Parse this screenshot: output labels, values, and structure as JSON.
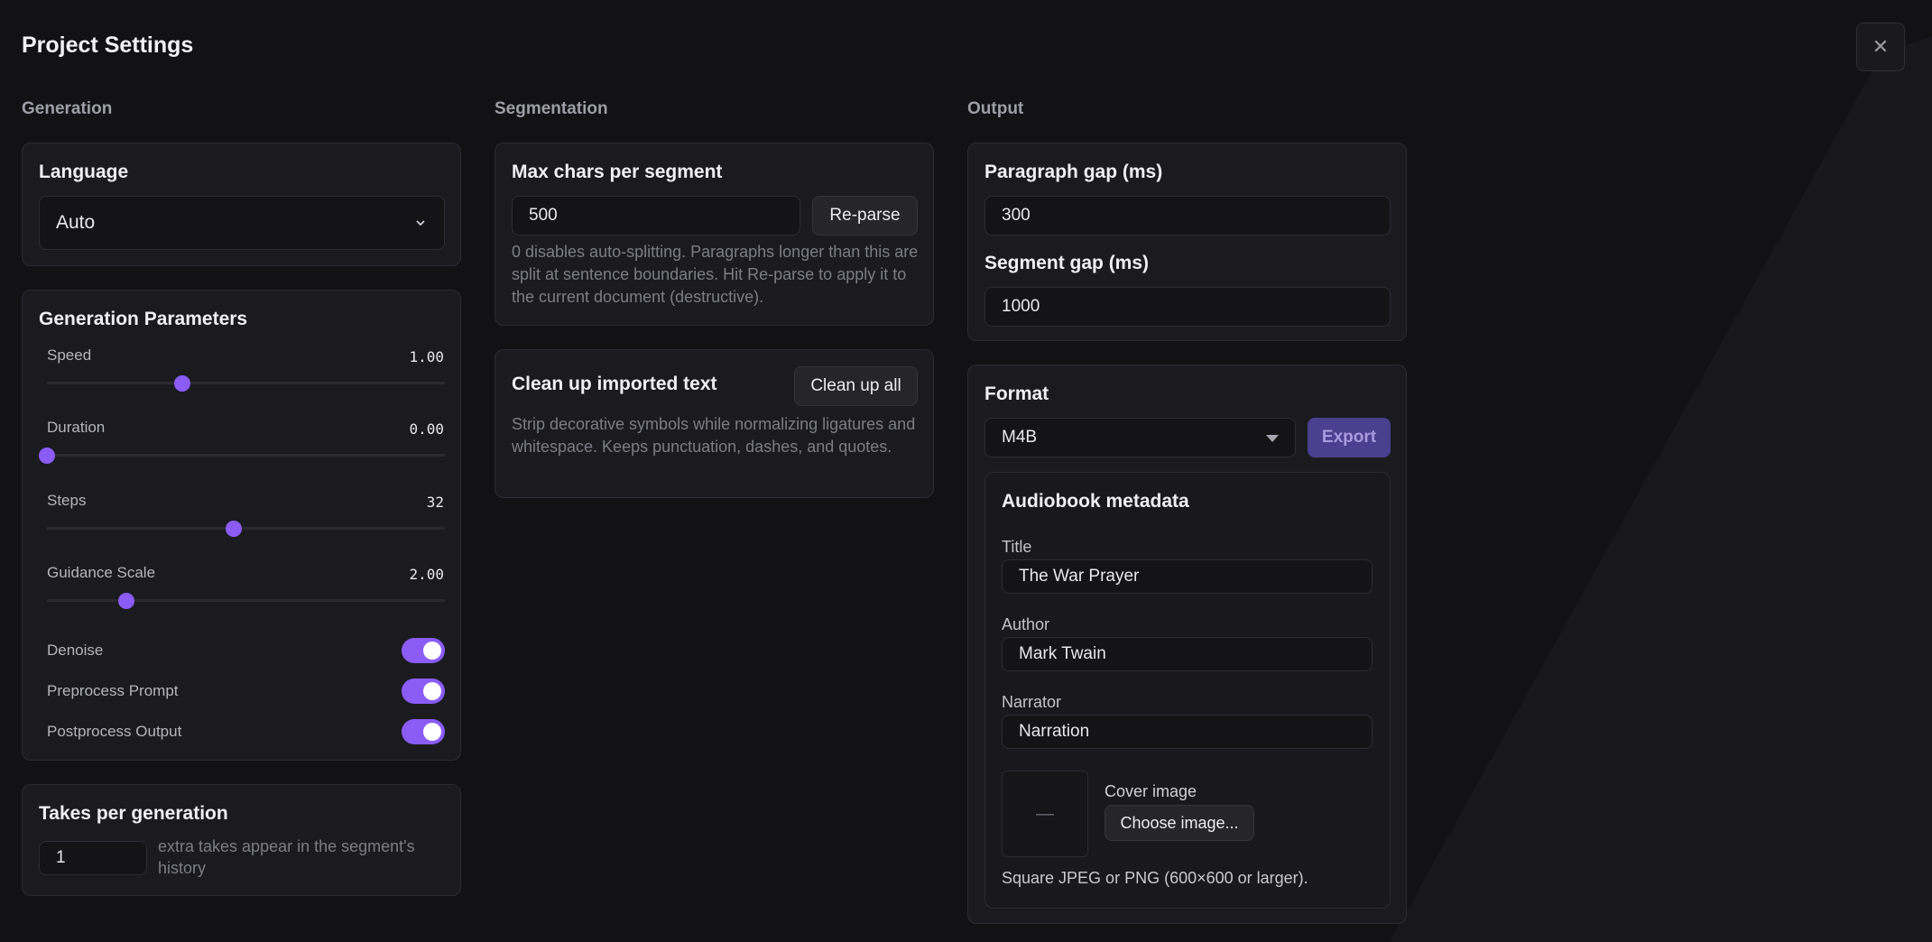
{
  "title": "Project Settings",
  "close_glyph": "✕",
  "columns": {
    "generation": "Generation",
    "segmentation": "Segmentation",
    "output": "Output"
  },
  "language": {
    "title": "Language",
    "value": "Auto"
  },
  "params": {
    "title": "Generation Parameters",
    "sliders": [
      {
        "label": "Speed",
        "display": "1.00",
        "fraction": 0.34
      },
      {
        "label": "Duration",
        "display": "0.00",
        "fraction": 0.0
      },
      {
        "label": "Steps",
        "display": "32",
        "fraction": 0.47
      },
      {
        "label": "Guidance Scale",
        "display": "2.00",
        "fraction": 0.2
      }
    ],
    "toggles": [
      {
        "label": "Denoise",
        "on": true
      },
      {
        "label": "Preprocess Prompt",
        "on": true
      },
      {
        "label": "Postprocess Output",
        "on": true
      }
    ]
  },
  "takes": {
    "title": "Takes per generation",
    "value": "1",
    "help": "extra takes appear in the segment's history"
  },
  "segment": {
    "title": "Max chars per segment",
    "value": "500",
    "reparse_label": "Re-parse",
    "help": "0 disables auto-splitting. Paragraphs longer than this are split at sentence boundaries. Hit Re-parse to apply it to the current document (destructive)."
  },
  "cleanup": {
    "title": "Clean up imported text",
    "button": "Clean up all",
    "help": "Strip decorative symbols while normalizing ligatures and whitespace. Keeps punctuation, dashes, and quotes."
  },
  "gaps": {
    "paragraph_label": "Paragraph gap (ms)",
    "paragraph_value": "300",
    "segment_label": "Segment gap (ms)",
    "segment_value": "1000"
  },
  "format": {
    "title": "Format",
    "value": "M4B",
    "export_label": "Export",
    "metadata": {
      "title": "Audiobook metadata",
      "title_label": "Title",
      "title_value": "The War Prayer",
      "author_label": "Author",
      "author_value": "Mark Twain",
      "narrator_label": "Narrator",
      "narrator_value": "Narration",
      "cover_label": "Cover image",
      "cover_placeholder": "—",
      "choose_label": "Choose image...",
      "cover_help": "Square JPEG or PNG (600×600 or larger)."
    }
  },
  "colors": {
    "accent": "#8b5cf6",
    "background": "#121215",
    "card": "#1b1b1f"
  }
}
